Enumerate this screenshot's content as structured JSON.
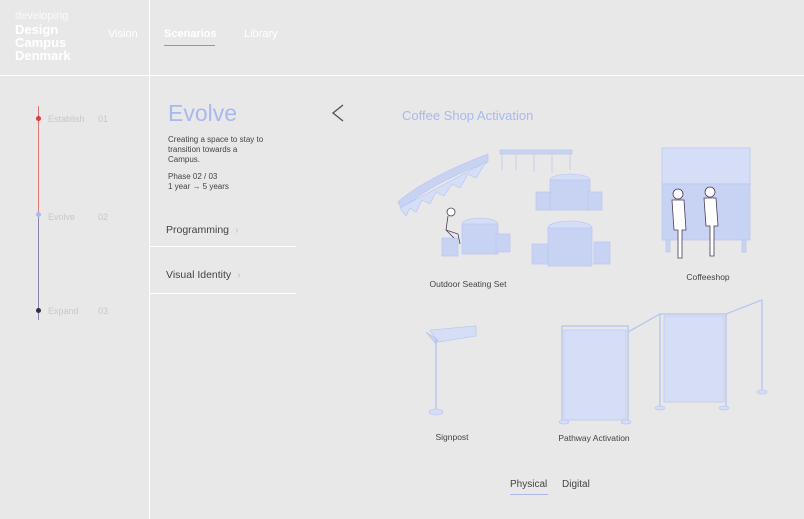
{
  "header": {
    "logo": {
      "line1": "developing",
      "line2": "Design",
      "line3": "Campus",
      "line4": "Denmark"
    },
    "nav": [
      {
        "label": "Vision"
      },
      {
        "label": "Scenarios"
      },
      {
        "label": "Library"
      }
    ]
  },
  "timeline": {
    "steps": [
      {
        "label": "Establish",
        "number": "01",
        "color": "#e03a3a"
      },
      {
        "label": "Evolve",
        "number": "02",
        "color": "#a9b9ee"
      },
      {
        "label": "Expand",
        "number": "03",
        "color": "#3a2a4a"
      }
    ]
  },
  "phase_panel": {
    "title": "Evolve",
    "description": "Creating a space to stay to transition towards a Campus.",
    "phase_line1": "Phase 02 / 03",
    "phase_line2": "1 year → 5 years",
    "menu": [
      {
        "label": "Programming"
      },
      {
        "label": "Visual Identity"
      }
    ]
  },
  "content": {
    "back_icon": "chevron-left-icon",
    "title": "Coffee Shop Activation",
    "items": [
      {
        "caption": "Outdoor Seating Set"
      },
      {
        "caption": "Coffeeshop"
      },
      {
        "caption": "Signpost"
      },
      {
        "caption": "Pathway Activation"
      }
    ],
    "tabs": [
      {
        "label": "Physical"
      },
      {
        "label": "Digital"
      }
    ]
  },
  "colors": {
    "accent": "#a9b9ee",
    "background": "#e8e8e8",
    "divider": "#ffffff"
  }
}
